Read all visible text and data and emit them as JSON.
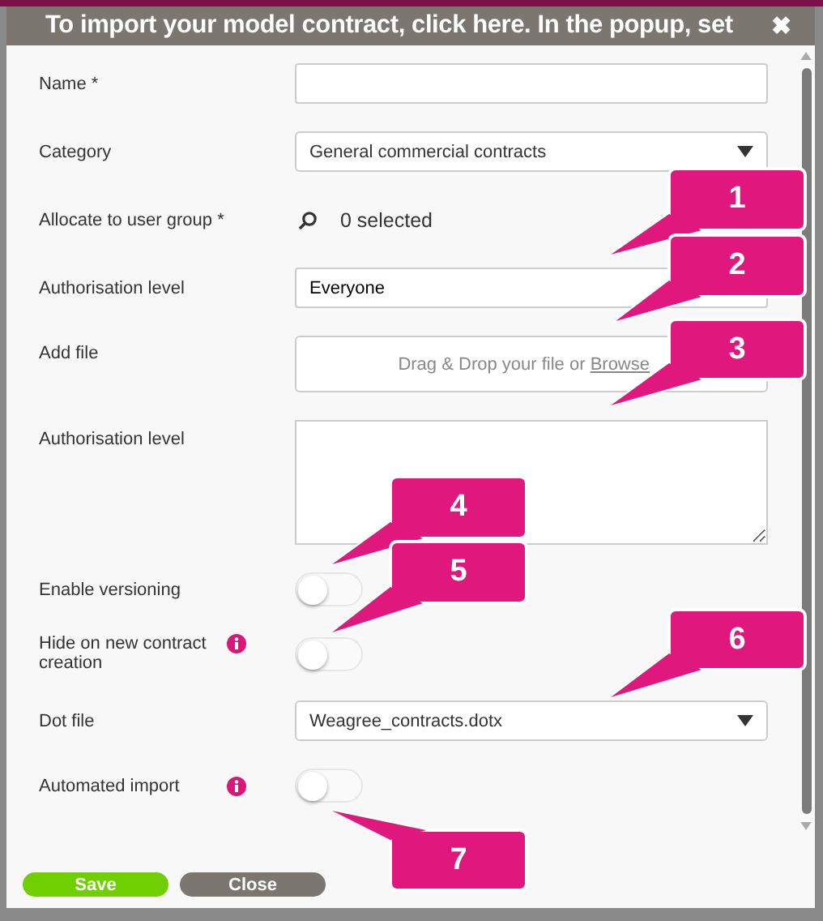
{
  "dialog": {
    "title": "To import your model contract, click here. In the popup, set",
    "close": "✖"
  },
  "fields": [
    {
      "kind": "text",
      "label": "Name *"
    },
    {
      "kind": "select",
      "label": "Category",
      "value": "General commercial contracts"
    },
    {
      "kind": "picker",
      "label": "Allocate to user group *",
      "value": "0 selected"
    },
    {
      "kind": "text",
      "label": "Authorisation level",
      "value": "Everyone"
    },
    {
      "kind": "file",
      "label": "Add file",
      "hint": "Drag & Drop your file or",
      "link": "Browse"
    },
    {
      "kind": "textarea",
      "label": "Authorisation level"
    },
    {
      "kind": "toggle",
      "label": "Enable versioning",
      "info": false,
      "on": false
    },
    {
      "kind": "toggle",
      "label": "Hide on new contract creation",
      "info": true,
      "on": false
    },
    {
      "kind": "select",
      "label": "Dot file",
      "value": "Weagree_contracts.dotx"
    },
    {
      "kind": "toggle",
      "label": "Automated import",
      "info": true,
      "on": false
    }
  ],
  "buttons": [
    {
      "kind": "primary",
      "label": "Save"
    },
    {
      "kind": "secondary",
      "label": "Close"
    }
  ],
  "callouts": [
    {
      "label": "1"
    },
    {
      "label": "2"
    },
    {
      "label": "3"
    },
    {
      "label": "4"
    },
    {
      "label": "5"
    },
    {
      "label": "6"
    },
    {
      "label": "7"
    }
  ]
}
